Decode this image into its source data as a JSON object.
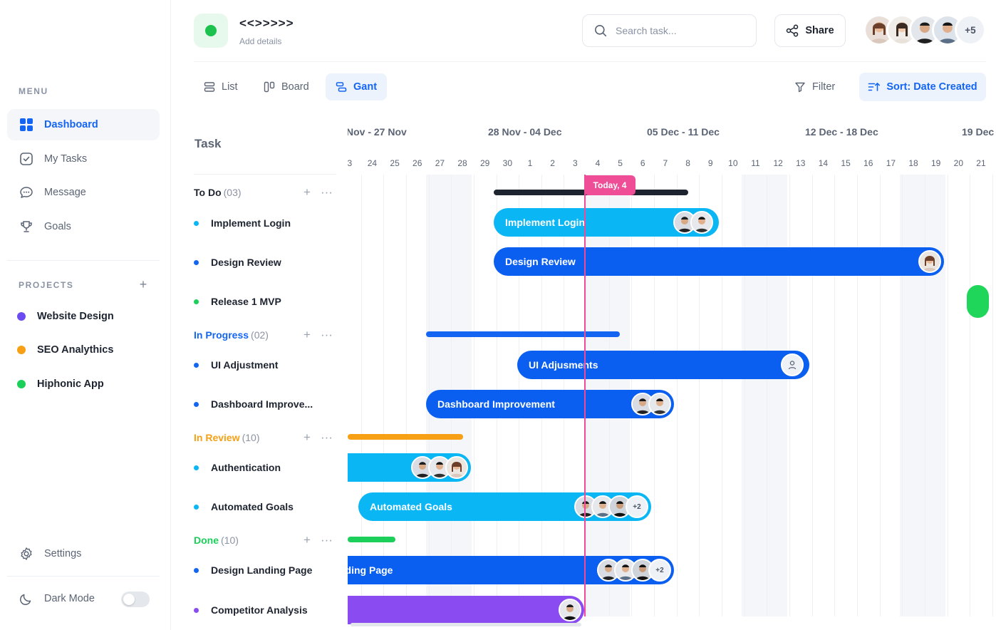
{
  "sidebar": {
    "menu_label": "MENU",
    "nav": [
      {
        "label": "Dashboard",
        "icon": "dashboard-grid-icon"
      },
      {
        "label": "My Tasks",
        "icon": "checkbox-icon"
      },
      {
        "label": "Message",
        "icon": "chat-bubble-icon"
      },
      {
        "label": "Goals",
        "icon": "trophy-icon"
      }
    ],
    "projects_label": "PROJECTS",
    "projects": [
      {
        "label": "Website Design",
        "color": "#6c4cf0"
      },
      {
        "label": "SEO Analythics",
        "color": "#f7a015"
      },
      {
        "label": "Hiphonic App",
        "color": "#1ccf5a"
      }
    ],
    "settings_label": "Settings",
    "dark_mode_label": "Dark Mode",
    "dark_mode_on": false
  },
  "header": {
    "project_title": "<<>>>>>",
    "project_subtitle": "Add details",
    "search_placeholder": "Search task...",
    "share_label": "Share",
    "extra_members": "+5"
  },
  "toolbar": {
    "views": [
      {
        "label": "List",
        "icon": "list-icon"
      },
      {
        "label": "Board",
        "icon": "board-icon"
      },
      {
        "label": "Gant",
        "icon": "gantt-icon"
      }
    ],
    "active_view": "Gant",
    "filter_label": "Filter",
    "sort_label": "Sort: Date Created"
  },
  "tasks": {
    "header": "Task",
    "groups": [
      {
        "label": "To Do",
        "count": "(03)",
        "color": "#1d2430",
        "items": [
          {
            "label": "Implement Login",
            "color": "#0bb6f5"
          },
          {
            "label": "Design Review",
            "color": "#1565f3"
          },
          {
            "label": "Release 1 MVP",
            "color": "#1ccf5a"
          }
        ]
      },
      {
        "label": "In Progress",
        "count": "(02)",
        "color": "#1565f3",
        "items": [
          {
            "label": "UI Adjustment",
            "color": "#1565f3"
          },
          {
            "label": "Dashboard Improve...",
            "color": "#1565f3"
          }
        ]
      },
      {
        "label": "In Review",
        "count": "(10)",
        "color": "#f7a015",
        "items": [
          {
            "label": "Authentication",
            "color": "#0bb6f5"
          },
          {
            "label": "Automated Goals",
            "color": "#0bb6f5"
          }
        ]
      },
      {
        "label": "Done",
        "count": "(10)",
        "color": "#1ccf5a",
        "items": [
          {
            "label": "Design Landing Page",
            "color": "#1565f3"
          },
          {
            "label": "Competitor Analysis",
            "color": "#8a4cf0"
          }
        ]
      }
    ]
  },
  "timeline": {
    "weeks": [
      "Nov - 27 Nov",
      "28 Nov - 04 Dec",
      "05 Dec - 11 Dec",
      "12 Dec - 18 Dec",
      "19 Dec"
    ],
    "days": [
      "3",
      "24",
      "25",
      "26",
      "27",
      "28",
      "29",
      "30",
      "1",
      "2",
      "3",
      "4",
      "5",
      "6",
      "7",
      "8",
      "9",
      "10",
      "11",
      "12",
      "13",
      "14",
      "15",
      "16",
      "17",
      "18",
      "19",
      "20",
      "21"
    ],
    "today_label": "Today, 4",
    "bars": [
      {
        "label": "Implement Login",
        "color": "#0bb6f5",
        "avatars": 2,
        "more": ""
      },
      {
        "label": "Design Review",
        "color": "#0a5ff0",
        "avatars": 1,
        "more": ""
      },
      {
        "label": "UI Adjusments",
        "color": "#0a5ff0",
        "avatars": 1,
        "more": ""
      },
      {
        "label": "Dashboard Improvement",
        "color": "#0a5ff0",
        "avatars": 2,
        "more": ""
      },
      {
        "label": "",
        "color": "#0bb6f5",
        "avatars": 3,
        "more": ""
      },
      {
        "label": "Automated Goals",
        "color": "#0bb6f5",
        "avatars": 3,
        "more": "+2"
      },
      {
        "label": "nding Page",
        "color": "#0a5ff0",
        "avatars": 3,
        "more": "+2"
      },
      {
        "label": "",
        "color": "#8a4cf0",
        "avatars": 1,
        "more": ""
      }
    ],
    "group_bars": [
      {
        "group": "To Do",
        "color": "#1d2430"
      },
      {
        "group": "In Progress",
        "color": "#1565f3"
      },
      {
        "group": "In Review",
        "color": "#f7a015"
      },
      {
        "group": "Done",
        "color": "#1ccf5a"
      }
    ]
  }
}
